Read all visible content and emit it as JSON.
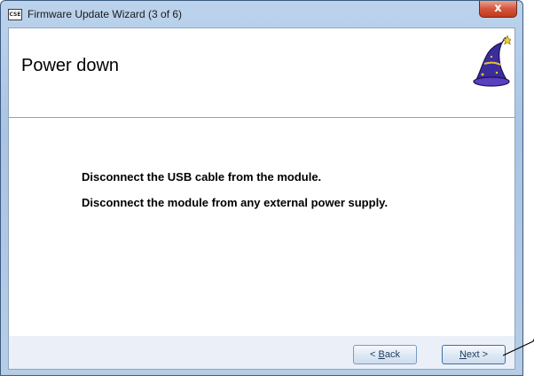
{
  "window": {
    "title": "Firmware Update Wizard (3 of 6)",
    "app_icon_text": "CSE",
    "close_label": "x"
  },
  "header": {
    "title": "Power down",
    "icon": "wizard-hat-icon"
  },
  "instructions": [
    "Disconnect the USB cable from the module.",
    "Disconnect the module from any external power supply."
  ],
  "footer": {
    "back_prefix": "< ",
    "back_key": "B",
    "back_rest": "ack",
    "next_key": "N",
    "next_rest": "ext >"
  },
  "colors": {
    "title_bar": "#bcd3ec",
    "close_button": "#c3381c",
    "footer_band": "#ebf0f8",
    "button_border": "#7a9bc2"
  }
}
